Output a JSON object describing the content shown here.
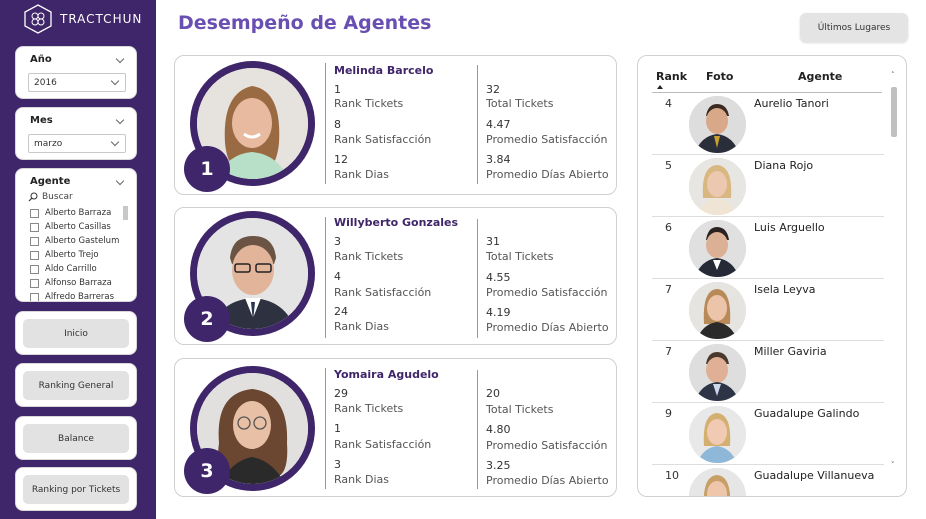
{
  "brand": {
    "name": "TRACTCHUN"
  },
  "page_title": "Desempeño de Agentes",
  "top_button": "Últimos Lugares",
  "filters": {
    "year": {
      "label": "Año",
      "value": "2016"
    },
    "month": {
      "label": "Mes",
      "value": "marzo"
    },
    "agent": {
      "label": "Agente",
      "search_placeholder": "Buscar",
      "options": [
        "Alberto Barraza",
        "Alberto Casillas",
        "Alberto Gastelum",
        "Alberto Trejo",
        "Aldo Carrillo",
        "Alfonso Barraza",
        "Alfredo Barreras"
      ]
    }
  },
  "nav": [
    {
      "label": "Inicio"
    },
    {
      "label": "Ranking General"
    },
    {
      "label": "Balance"
    },
    {
      "label": "Ranking por Tickets"
    }
  ],
  "top_agents": [
    {
      "position": "1",
      "name": "Melinda Barcelo",
      "rank_tickets": "1",
      "rank_tickets_label": "Rank Tickets",
      "rank_satisfaccion": "8",
      "rank_satisfaccion_label": "Rank Satisfacción",
      "rank_dias": "12",
      "rank_dias_label": "Rank Dias",
      "total_tickets": "32",
      "total_tickets_label": "Total Tickets",
      "promedio_satisfaccion": "4.47",
      "promedio_satisfaccion_label": "Promedio Satisfacción",
      "promedio_dias": "3.84",
      "promedio_dias_label": "Promedio Días Abierto"
    },
    {
      "position": "2",
      "name": "Willyberto Gonzales",
      "rank_tickets": "3",
      "rank_tickets_label": "Rank Tickets",
      "rank_satisfaccion": "4",
      "rank_satisfaccion_label": "Rank Satisfacción",
      "rank_dias": "24",
      "rank_dias_label": "Rank Dias",
      "total_tickets": "31",
      "total_tickets_label": "Total Tickets",
      "promedio_satisfaccion": "4.55",
      "promedio_satisfaccion_label": "Promedio Satisfacción",
      "promedio_dias": "4.19",
      "promedio_dias_label": "Promedio Días Abierto"
    },
    {
      "position": "3",
      "name": "Yomaira Agudelo",
      "rank_tickets": "29",
      "rank_tickets_label": "Rank Tickets",
      "rank_satisfaccion": "1",
      "rank_satisfaccion_label": "Rank Satisfacción",
      "rank_dias": "3",
      "rank_dias_label": "Rank Dias",
      "total_tickets": "20",
      "total_tickets_label": "Total Tickets",
      "promedio_satisfaccion": "4.80",
      "promedio_satisfaccion_label": "Promedio Satisfacción",
      "promedio_dias": "3.25",
      "promedio_dias_label": "Promedio Días Abierto"
    }
  ],
  "table": {
    "headers": {
      "rank": "Rank",
      "foto": "Foto",
      "agente": "Agente"
    },
    "rows": [
      {
        "rank": "4",
        "name": "Aurelio Tanori"
      },
      {
        "rank": "5",
        "name": "Diana Rojo"
      },
      {
        "rank": "6",
        "name": "Luis Arguello"
      },
      {
        "rank": "7",
        "name": "Isela Leyva"
      },
      {
        "rank": "7",
        "name": "Miller Gaviria"
      },
      {
        "rank": "9",
        "name": "Guadalupe Galindo"
      },
      {
        "rank": "10",
        "name": "Guadalupe Villanueva"
      }
    ]
  },
  "colors": {
    "sidebar": "#3f2569",
    "title": "#6a4fb3",
    "accent": "#3f2569"
  },
  "icons": {
    "logo": "hexagon-logo-icon",
    "chevron": "chevron-down-icon",
    "search": "search-icon"
  }
}
